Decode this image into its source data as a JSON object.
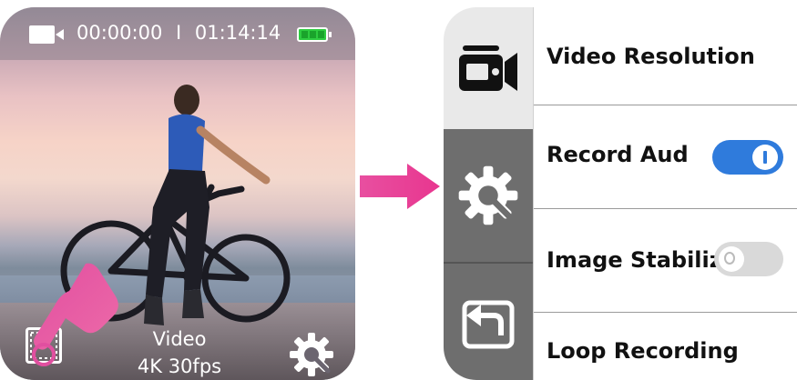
{
  "camera_screen": {
    "recording_time": "00:00:00",
    "separator": "I",
    "remaining_time": "01:14:14",
    "mode_name": "Video",
    "mode_setting": "4K 30fps",
    "icons": [
      "video-camera-icon",
      "battery-icon",
      "gallery-icon",
      "settings-gear-icon",
      "pointing-hand-icon"
    ]
  },
  "menu": {
    "items": [
      {
        "label": "Video Resolution"
      },
      {
        "label": "Record Audio",
        "toggle": "on"
      },
      {
        "label": "Image Stabilization",
        "toggle": "off"
      },
      {
        "label": "Loop Recording"
      }
    ],
    "rail_icons": [
      "video-camera-icon",
      "settings-gear-icon",
      "back-arrow-icon"
    ]
  },
  "colors": {
    "toggle_on": "#2f7bdc",
    "toggle_off": "#d9d9d9",
    "arrow": "#e84fa0",
    "battery": "#2ecc40"
  }
}
